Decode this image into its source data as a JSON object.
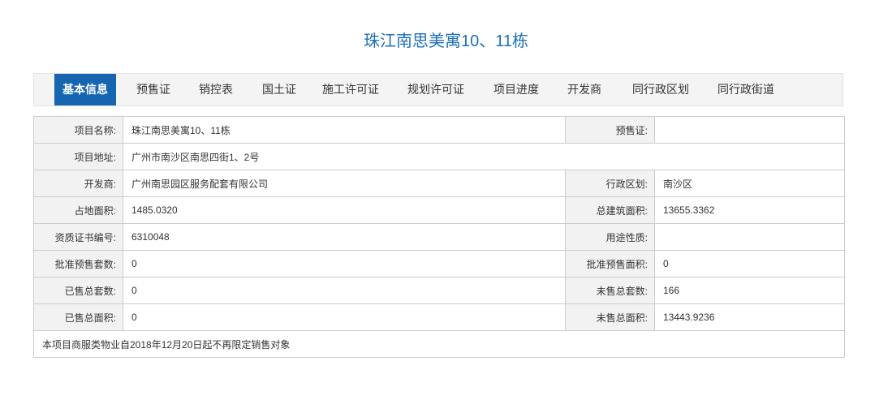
{
  "page_title": "珠江南思美寓10、11栋",
  "tabs": [
    {
      "label": "基本信息",
      "active": true
    },
    {
      "label": "预售证",
      "active": false
    },
    {
      "label": "销控表",
      "active": false
    },
    {
      "label": "国土证",
      "active": false
    },
    {
      "label": "施工许可证",
      "active": false
    },
    {
      "label": "规划许可证",
      "active": false
    },
    {
      "label": "项目进度",
      "active": false
    },
    {
      "label": "开发商",
      "active": false
    },
    {
      "label": "同行政区划",
      "active": false
    },
    {
      "label": "同行政街道",
      "active": false
    }
  ],
  "info": {
    "project_name_label": "项目名称:",
    "project_name": "珠江南思美寓10、11栋",
    "presale_cert_label": "预售证:",
    "presale_cert": "",
    "address_label": "项目地址:",
    "address": "广州市南沙区南思四街1、2号",
    "developer_label": "开发商:",
    "developer": "广州南思园区服务配套有限公司",
    "district_label": "行政区划:",
    "district": "南沙区",
    "land_area_label": "占地面积:",
    "land_area": "1485.0320",
    "total_build_area_label": "总建筑面积:",
    "total_build_area": "13655.3362",
    "qualification_no_label": "资质证书编号:",
    "qualification_no": "6310048",
    "usage_label": "用途性质:",
    "usage": "",
    "approved_units_label": "批准预售套数:",
    "approved_units": "0",
    "approved_area_label": "批准预售面积:",
    "approved_area": "0",
    "sold_units_label": "已售总套数:",
    "sold_units": "0",
    "unsold_units_label": "未售总套数:",
    "unsold_units": "166",
    "sold_area_label": "已售总面积:",
    "sold_area": "0",
    "unsold_area_label": "未售总面积:",
    "unsold_area": "13443.9236",
    "note": "本项目商服类物业自2018年12月20日起不再限定销售对象"
  }
}
